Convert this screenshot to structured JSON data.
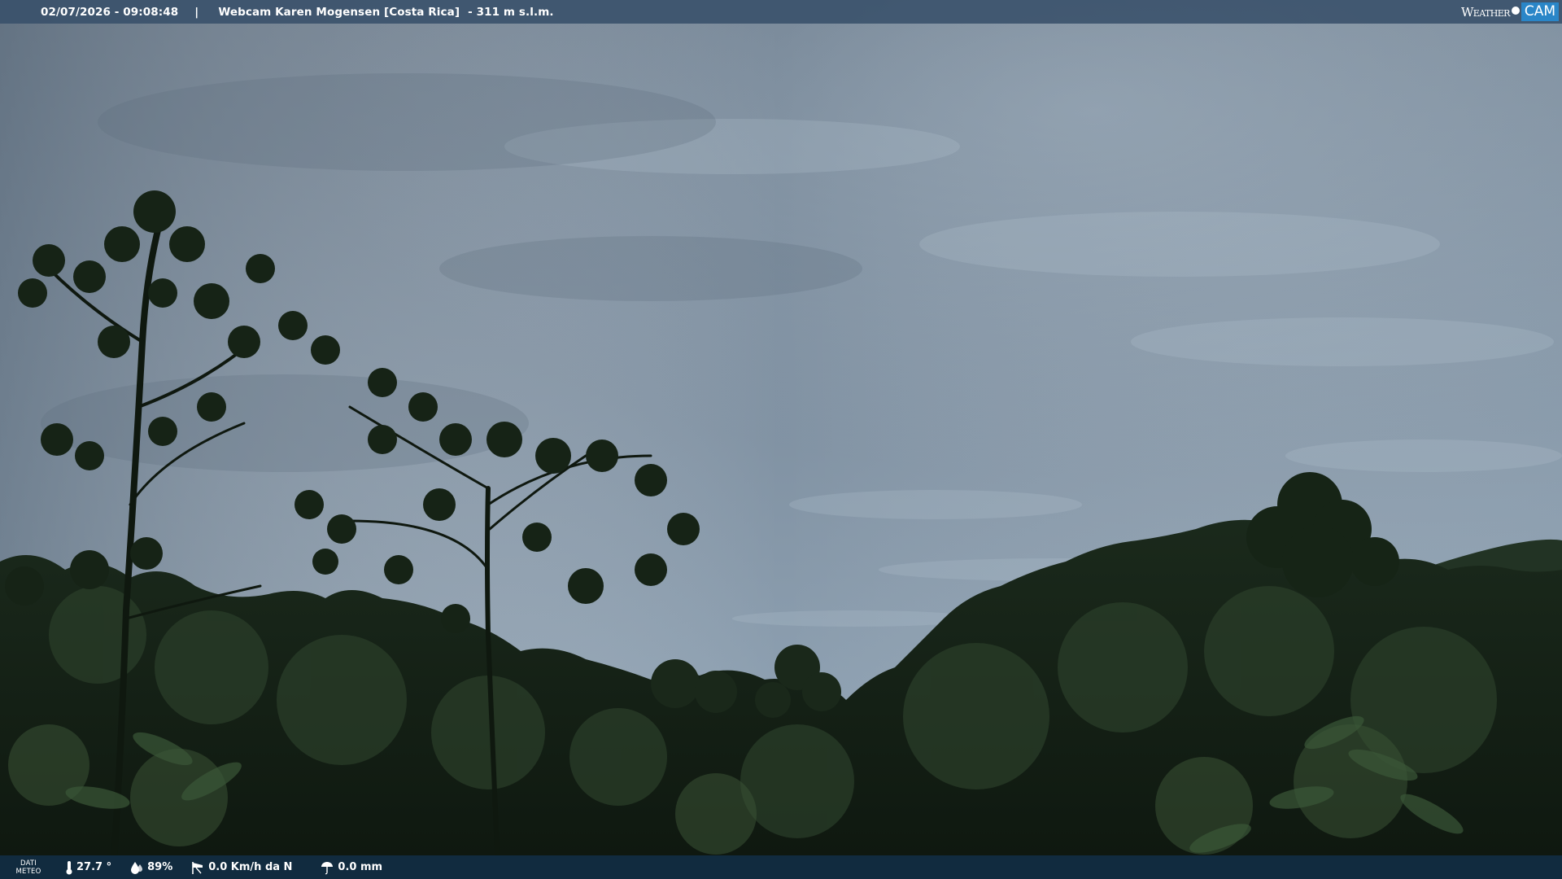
{
  "header": {
    "datetime": "02/07/2026 - 09:08:48",
    "separator": "|",
    "title": "Webcam Karen Mogensen [Costa Rica]",
    "altitude": "- 311 m s.l.m."
  },
  "brand": {
    "word1": "Weather",
    "word2": "CAM",
    "accent_color": "#2a86c8"
  },
  "weather_bar": {
    "label_line1": "DATI",
    "label_line2": "METEO",
    "temperature": "27.7 °",
    "humidity": "89%",
    "wind": "0.0 Km/h da N",
    "rain": "0.0 mm",
    "icons": [
      "thermometer-icon",
      "humidity-drop-icon",
      "wind-sock-icon",
      "rain-umbrella-icon"
    ]
  },
  "colors": {
    "header_bg": "#38506a",
    "footer_bg": "#12304a",
    "sky_top": "#6e7f90",
    "sky_bottom": "#8fa3b4",
    "foliage_dark": "#101a10"
  }
}
